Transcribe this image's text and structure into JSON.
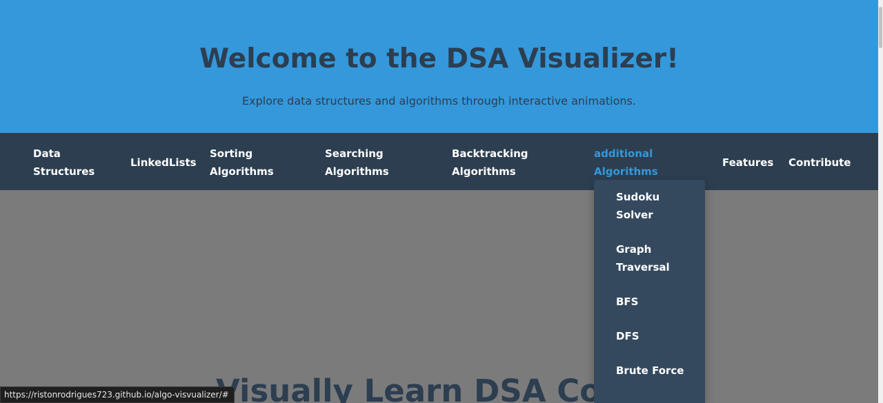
{
  "hero": {
    "title": "Welcome to the DSA Visualizer!",
    "subtitle": "Explore data structures and algorithms through interactive animations."
  },
  "navbar": {
    "items": [
      {
        "line1": "Data",
        "line2": "Structures"
      },
      {
        "line1": "LinkedLists"
      },
      {
        "line1": "Sorting",
        "line2": "Algorithms"
      },
      {
        "line1": "Searching",
        "line2": "Algorithms"
      },
      {
        "line1": "Backtracking",
        "line2": "Algorithms"
      },
      {
        "line1": "additional",
        "line2": "Algorithms"
      },
      {
        "line1": "Features"
      },
      {
        "line1": "Contribute"
      }
    ]
  },
  "dropdown": {
    "items": [
      {
        "line1": "Sudoku",
        "line2": "Solver"
      },
      {
        "line1": "Graph",
        "line2": "Traversal"
      },
      {
        "line1": "BFS"
      },
      {
        "line1": "DFS"
      },
      {
        "line1": "Brute Force"
      }
    ]
  },
  "main": {
    "section_title": "Visually Learn DSA Conc"
  },
  "status_bar": {
    "url": "https://ristonrodrigues723.github.io/algo-visvualizer/#"
  },
  "colors": {
    "hero_bg": "#3498db",
    "navbar_bg": "#2c3e50",
    "dropdown_bg": "#34495e",
    "active_link": "#3498db",
    "overlay_bg": "#7b7b7b",
    "heading_text": "#2c3e50"
  }
}
